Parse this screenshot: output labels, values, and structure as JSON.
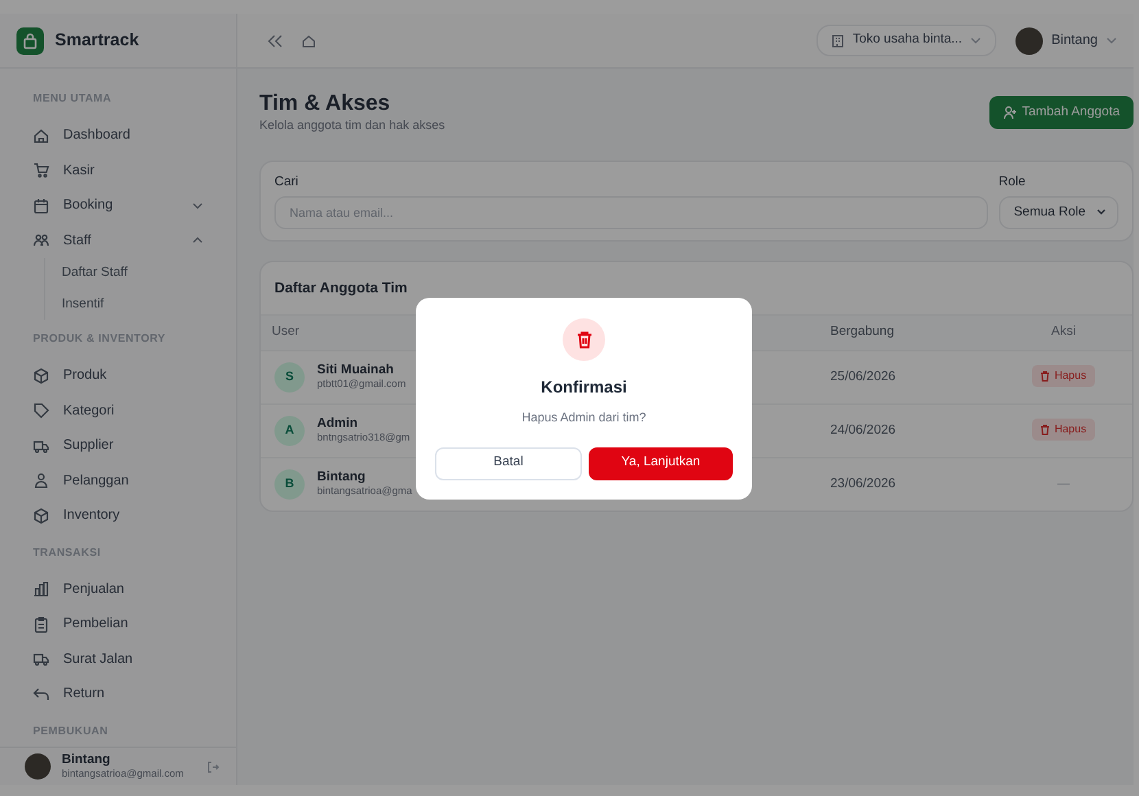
{
  "brand": "Smartrack",
  "sidebar": {
    "sections": [
      {
        "label": "MENU UTAMA",
        "items": [
          {
            "label": "Dashboard"
          },
          {
            "label": "Kasir"
          },
          {
            "label": "Booking",
            "expanded": false
          },
          {
            "label": "Staff",
            "expanded": true,
            "children": [
              {
                "label": "Daftar Staff"
              },
              {
                "label": "Insentif"
              }
            ]
          }
        ]
      },
      {
        "label": "PRODUK & INVENTORY",
        "items": [
          {
            "label": "Produk"
          },
          {
            "label": "Kategori"
          },
          {
            "label": "Supplier"
          },
          {
            "label": "Pelanggan"
          },
          {
            "label": "Inventory"
          }
        ]
      },
      {
        "label": "TRANSAKSI",
        "items": [
          {
            "label": "Penjualan"
          },
          {
            "label": "Pembelian"
          },
          {
            "label": "Surat Jalan"
          },
          {
            "label": "Return"
          }
        ]
      },
      {
        "label": "PEMBUKUAN"
      }
    ],
    "user": {
      "name": "Bintang",
      "email": "bintangsatrioa@gmail.com"
    }
  },
  "header": {
    "store": "Toko usaha binta...",
    "user": "Bintang"
  },
  "page": {
    "title": "Tim & Akses",
    "subtitle": "Kelola anggota tim dan hak akses",
    "add_button": "Tambah Anggota"
  },
  "filter": {
    "search_label": "Cari",
    "search_placeholder": "Nama atau email...",
    "role_label": "Role",
    "role_value": "Semua Role"
  },
  "members": {
    "title": "Daftar Anggota Tim",
    "columns": [
      "User",
      "Bergabung",
      "Aksi"
    ],
    "rows": [
      {
        "initial": "S",
        "name": "Siti Muainah",
        "email": "ptbtt01@gmail.com",
        "joined": "25/06/2026",
        "action": {
          "kind": "delete",
          "label": "Hapus"
        }
      },
      {
        "initial": "A",
        "name": "Admin",
        "email": "bntngsatrio318@gm",
        "joined": "24/06/2026",
        "action": {
          "kind": "delete",
          "label": "Hapus"
        }
      },
      {
        "initial": "B",
        "name": "Bintang",
        "email": "bintangsatrioa@gma",
        "joined": "23/06/2026",
        "action": {
          "kind": "none",
          "label": "—"
        }
      }
    ]
  },
  "modal": {
    "title": "Konfirmasi",
    "message": "Hapus Admin dari tim?",
    "cancel": "Batal",
    "confirm": "Ya, Lanjutkan"
  }
}
